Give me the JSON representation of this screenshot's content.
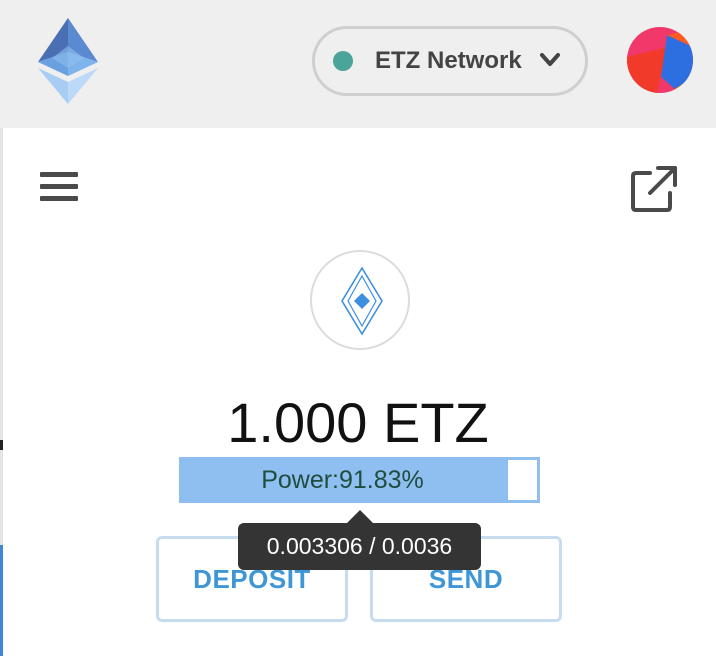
{
  "header": {
    "logo_icon": "ethereum-diamond-icon",
    "network": {
      "label": "ETZ Network",
      "status_color": "#4aa49a",
      "dropdown_icon": "chevron-down-icon"
    },
    "account_icon": "account-identicon"
  },
  "toolbar": {
    "menu_icon": "hamburger-menu-icon",
    "expand_icon": "open-in-new-window-icon"
  },
  "wallet": {
    "token_icon": "etz-token-icon",
    "balance": "1.000 ETZ",
    "power": {
      "label": "Power:91.83%",
      "fraction": 0.9183,
      "fill_color": "#8fbef0"
    },
    "tooltip": "0.003306 / 0.0036"
  },
  "actions": {
    "deposit_label": "DEPOSIT",
    "send_label": "SEND",
    "accent_color": "#3f96d6"
  }
}
